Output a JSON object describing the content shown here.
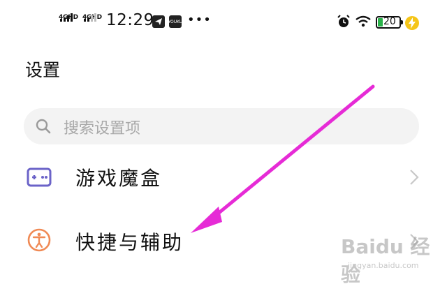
{
  "status_bar": {
    "sim1": "4GHD",
    "sim2": "4GHD",
    "time": "12:29",
    "app_icon_1": "telegram-icon",
    "app_icon_2": "YOUKU",
    "more": "•••",
    "battery": "20",
    "icons": [
      "alarm-icon",
      "wifi-icon",
      "battery-icon",
      "charging-bolt-icon"
    ]
  },
  "page": {
    "title": "设置"
  },
  "search": {
    "placeholder": "搜索设置项"
  },
  "settings_items": [
    {
      "label": "游戏魔盒",
      "icon": "game-box-icon",
      "icon_color": "#6b63c8"
    },
    {
      "label": "快捷与辅助",
      "icon": "accessibility-icon",
      "icon_color": "#f08a55"
    }
  ],
  "annotation": {
    "arrow_color": "#e62bd6"
  },
  "watermark": {
    "text": "Baidu 经验",
    "sub": "jingyan.baidu.com"
  }
}
